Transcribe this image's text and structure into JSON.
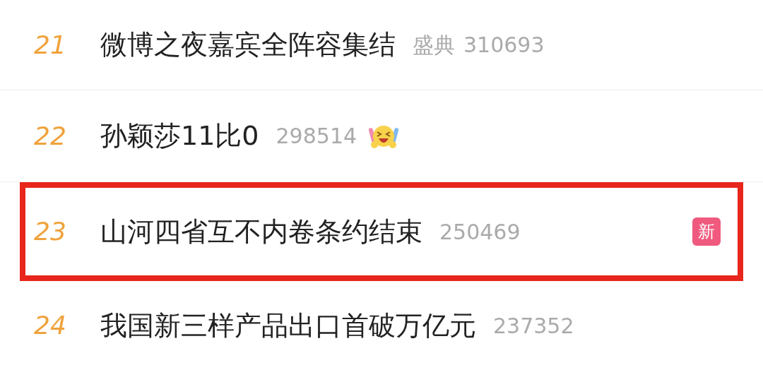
{
  "hot_list": [
    {
      "rank": "21",
      "title": "微博之夜嘉宾全阵容集结",
      "tag": "盛典",
      "count": "310693",
      "highlighted": false
    },
    {
      "rank": "22",
      "title": "孙颖莎11比0",
      "count": "298514",
      "emoji": true,
      "highlighted": false
    },
    {
      "rank": "23",
      "title": "山河四省互不内卷条约结束",
      "count": "250469",
      "badge": "新",
      "highlighted": true
    },
    {
      "rank": "24",
      "title": "我国新三样产品出口首破万亿元",
      "count": "237352",
      "highlighted": false
    }
  ]
}
